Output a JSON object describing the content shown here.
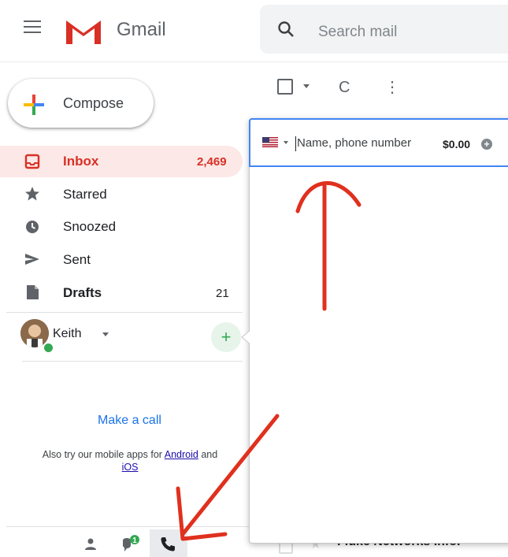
{
  "header": {
    "app_name": "Gmail",
    "search_placeholder": "Search mail"
  },
  "toolbar": {
    "refresh_glyph": "C",
    "more_glyph": "⋮"
  },
  "compose": {
    "label": "Compose"
  },
  "nav": {
    "items": [
      {
        "label": "Inbox",
        "count": "2,469",
        "icon": "inbox-icon"
      },
      {
        "label": "Starred",
        "count": "",
        "icon": "star-icon"
      },
      {
        "label": "Snoozed",
        "count": "",
        "icon": "clock-icon"
      },
      {
        "label": "Sent",
        "count": "",
        "icon": "send-icon"
      },
      {
        "label": "Drafts",
        "count": "21",
        "icon": "draft-icon"
      }
    ]
  },
  "hangouts": {
    "user_name": "Keith",
    "add_label": "+",
    "make_call": "Make a call",
    "apps_prefix": "Also try our mobile apps for",
    "android": "Android",
    "and": "and",
    "ios": "iOS",
    "chat_badge": "1"
  },
  "dialer": {
    "placeholder": "Name, phone number",
    "credit": "$0.00",
    "add_credit": "+"
  },
  "list_peek": {
    "sender": "Fluke Networks Info."
  },
  "colors": {
    "accent": "#1a73e8",
    "inbox_red": "#d93025",
    "annotation_red": "#e0301e"
  }
}
